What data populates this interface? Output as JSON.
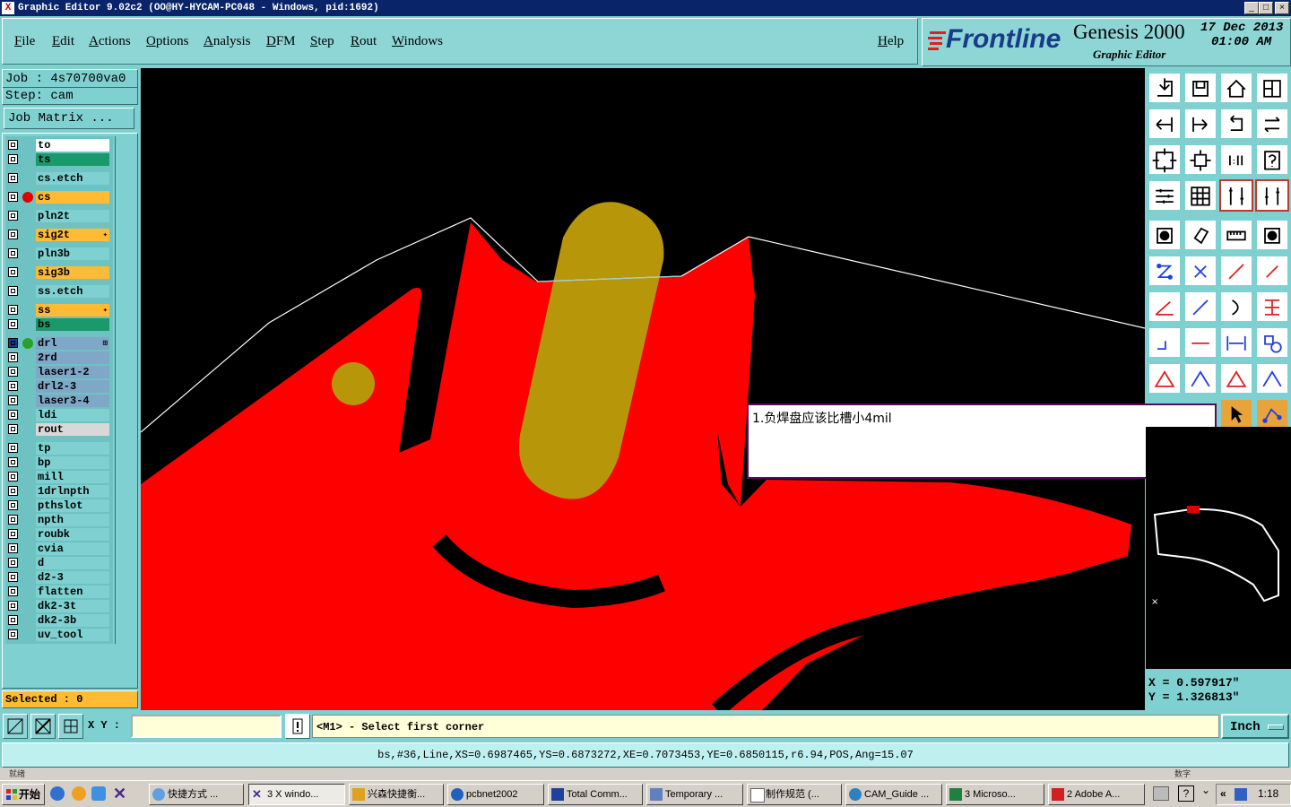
{
  "window": {
    "title": "Graphic Editor 9.02c2  (OO@HY-HYCAM-PC048 - Windows, pid:1692)",
    "icon": "x-app-icon",
    "controls": [
      "_",
      "□",
      "×"
    ]
  },
  "menu": {
    "items": [
      "File",
      "Edit",
      "Actions",
      "Options",
      "Analysis",
      "DFM",
      "Step",
      "Rout",
      "Windows"
    ],
    "help": "Help"
  },
  "brand": {
    "logo": "Frontline",
    "product": "Genesis 2000",
    "subtitle": "Graphic Editor",
    "date": "17 Dec 2013",
    "time": "01:00 AM"
  },
  "job": {
    "job_line": "Job : 4s70700va0",
    "step_line": "Step: cam",
    "matrix_button": "Job Matrix ..."
  },
  "layers": [
    {
      "name": "to",
      "bg": "#ffffff",
      "dot": null,
      "mark": ""
    },
    {
      "name": "ts",
      "bg": "#1a9a6a",
      "dot": null,
      "mark": ""
    },
    {
      "name": "cs.etch",
      "bg": "#7fd0d0",
      "dot": null,
      "mark": ""
    },
    {
      "name": "cs",
      "bg": "#ffbb33",
      "dot": "#e00000",
      "mark": ""
    },
    {
      "name": "pln2t",
      "bg": "#7fd0d0",
      "dot": null,
      "mark": ""
    },
    {
      "name": "sig2t",
      "bg": "#ffbb33",
      "dot": null,
      "mark": "✦"
    },
    {
      "name": "pln3b",
      "bg": "#7fd0d0",
      "dot": null,
      "mark": ""
    },
    {
      "name": "sig3b",
      "bg": "#ffbb33",
      "dot": null,
      "mark": ""
    },
    {
      "name": "ss.etch",
      "bg": "#7fd0d0",
      "dot": null,
      "mark": ""
    },
    {
      "name": "ss",
      "bg": "#ffbb33",
      "dot": null,
      "mark": "✦"
    },
    {
      "name": "bs",
      "bg": "#1a9a6a",
      "dot": null,
      "mark": ""
    },
    {
      "name": "drl",
      "bg": "#7fa8c8",
      "dot": "#2aa02a",
      "mark": "⊞"
    },
    {
      "name": "2rd",
      "bg": "#7fa8c8",
      "dot": null,
      "mark": ""
    },
    {
      "name": "laser1-2",
      "bg": "#7fa8c8",
      "dot": null,
      "mark": ""
    },
    {
      "name": "drl2-3",
      "bg": "#7fa8c8",
      "dot": null,
      "mark": ""
    },
    {
      "name": "laser3-4",
      "bg": "#7fa8c8",
      "dot": null,
      "mark": ""
    },
    {
      "name": "ldi",
      "bg": "#7fd0d0",
      "dot": null,
      "mark": ""
    },
    {
      "name": "rout",
      "bg": "#d8d8d8",
      "dot": null,
      "mark": ""
    },
    {
      "name": "tp",
      "bg": "#7fd0d0",
      "dot": null,
      "mark": ""
    },
    {
      "name": "bp",
      "bg": "#7fd0d0",
      "dot": null,
      "mark": ""
    },
    {
      "name": "mill",
      "bg": "#7fd0d0",
      "dot": null,
      "mark": ""
    },
    {
      "name": "1drlnpth",
      "bg": "#7fd0d0",
      "dot": null,
      "mark": ""
    },
    {
      "name": "pthslot",
      "bg": "#7fd0d0",
      "dot": null,
      "mark": ""
    },
    {
      "name": "npth",
      "bg": "#7fd0d0",
      "dot": null,
      "mark": ""
    },
    {
      "name": "roubk",
      "bg": "#7fd0d0",
      "dot": null,
      "mark": ""
    },
    {
      "name": "cvia",
      "bg": "#7fd0d0",
      "dot": null,
      "mark": ""
    },
    {
      "name": "d",
      "bg": "#7fd0d0",
      "dot": null,
      "mark": ""
    },
    {
      "name": "d2-3",
      "bg": "#7fd0d0",
      "dot": null,
      "mark": ""
    },
    {
      "name": "flatten",
      "bg": "#7fd0d0",
      "dot": null,
      "mark": ""
    },
    {
      "name": "dk2-3t",
      "bg": "#7fd0d0",
      "dot": null,
      "mark": ""
    },
    {
      "name": "dk2-3b",
      "bg": "#7fd0d0",
      "dot": null,
      "mark": ""
    },
    {
      "name": "uv_tool",
      "bg": "#7fd0d0",
      "dot": null,
      "mark": ""
    }
  ],
  "selected": "Selected : 0",
  "note": "1.负焊盘应该比槽小4mil",
  "coords": {
    "x": "X  =  0.597917\"",
    "y": "Y  =  1.326813\""
  },
  "status": {
    "xy_label": "X Y :",
    "xy_value": "",
    "prompt": "<M1> - Select first corner",
    "units": "Inch",
    "info": "bs,#36,Line,XS=0.6987465,YS=0.6873272,XE=0.7073453,YE=0.6850115,r6.94,POS,Ang=15.07"
  },
  "taskbar": {
    "start": "开始",
    "tasks": [
      "快捷方式 ...",
      "3 X windo...",
      "兴森快捷衡...",
      "pcbnet2002",
      "Total Comm...",
      "Temporary ...",
      "制作规范 (...",
      "CAM_Guide ...",
      "3 Microso...",
      "2 Adobe A..."
    ],
    "clock": "1:18",
    "hidden_left": "就绪",
    "hidden_right": "数字"
  },
  "colors": {
    "canvas": "#000000",
    "copper": "#ff0000",
    "pad": "#b8960a",
    "panel": "#7fd0d0"
  }
}
